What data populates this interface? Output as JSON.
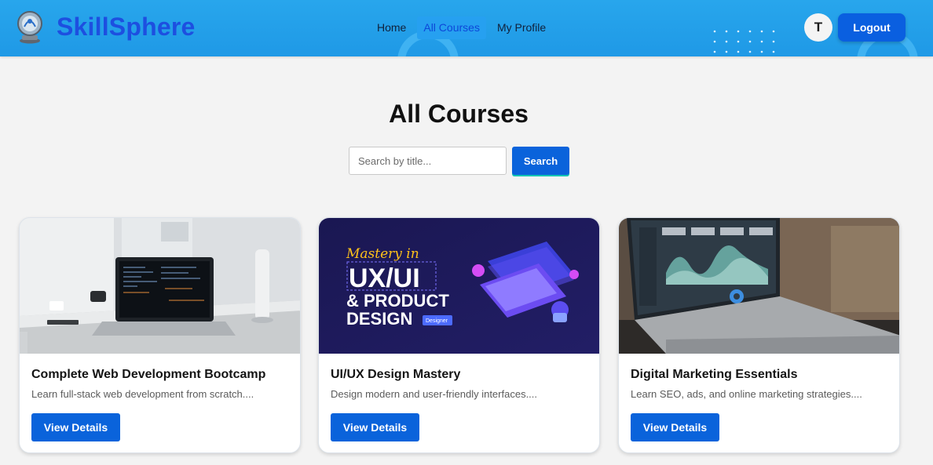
{
  "header": {
    "brand": "SkillSphere",
    "nav": [
      {
        "label": "Home",
        "active": false
      },
      {
        "label": "All Courses",
        "active": true
      },
      {
        "label": "My Profile",
        "active": false
      }
    ],
    "avatar_initial": "T",
    "logout_label": "Logout"
  },
  "main": {
    "title": "All Courses",
    "search": {
      "placeholder": "Search by title...",
      "value": "",
      "button_label": "Search"
    }
  },
  "courses": [
    {
      "title": "Complete Web Development Bootcamp",
      "description": "Learn full-stack web development from scratch....",
      "button_label": "View Details"
    },
    {
      "title": "UI/UX Design Mastery",
      "description": "Design modern and user-friendly interfaces....",
      "button_label": "View Details",
      "image_text": {
        "line1": "Mastery in",
        "line2": "UX/UI",
        "line3": "& PRODUCT",
        "line4": "DESIGN",
        "badge": "Designer"
      }
    },
    {
      "title": "Digital Marketing Essentials",
      "description": "Learn SEO, ads, and online marketing strategies....",
      "button_label": "View Details"
    }
  ],
  "colors": {
    "header": "#1f99e6",
    "brand": "#1d4fe0",
    "primary_button": "#0a63db",
    "page_bg": "#f3f3f3"
  }
}
